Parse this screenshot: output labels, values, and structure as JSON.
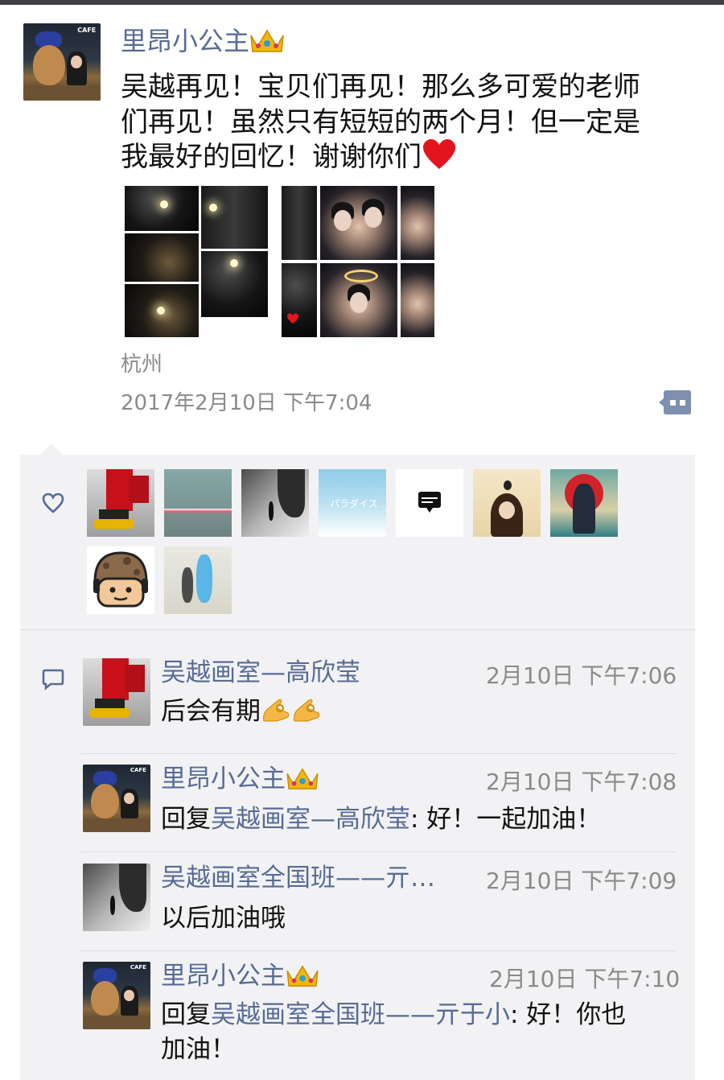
{
  "post": {
    "author": "里昂小公主",
    "author_icon": "crown-emoji",
    "text_lines": [
      "吴越再见！宝贝们再见！那么多可爱的老师",
      "们再见！虽然只有短短的两个月！但一定是",
      "我最好的回忆！谢谢你们"
    ],
    "text_end_icon": "red-heart-emoji",
    "location": "杭州",
    "timestamp": "2017年2月10日 下午7:04"
  },
  "likes": {
    "icon": "heart-outline-icon",
    "avatars": [
      "red-pants-sneakers",
      "teal-gradient-pink-line",
      "snowy-forest-bw",
      "sky-clouds-japanese-text",
      "black-speech-bubble-logo",
      "illustrated-girl-with-bird",
      "armored-hero-illustration",
      "cartoon-soldier-helmet",
      "figures-in-field"
    ],
    "avatar_caption_text": "パラダイス"
  },
  "comments_icon": "comment-bubble-icon",
  "comments": [
    {
      "author": "吴越画室—高欣莹",
      "time": "2月10日 下午7:06",
      "text": "后会有期",
      "emoji": "ok-hand-emoji ×2"
    },
    {
      "author": "里昂小公主",
      "time": "2月10日 下午7:08",
      "reply_prefix": "回复",
      "reply_to": "吴越画室—高欣莹",
      "text": ": 好！一起加油！"
    },
    {
      "author": "吴越画室全国班——亓…",
      "time": "2月10日 下午7:09",
      "text": "以后加油哦"
    },
    {
      "author": "里昂小公主",
      "time": "2月10日 下午7:10",
      "reply_prefix": "回复",
      "reply_to": "吴越画室全国班——亓于小",
      "text": ": 好！你也",
      "text_line2": "加油！"
    }
  ],
  "avatar_label": "CAFE",
  "colors": {
    "name_blue": "#576b95",
    "meta_gray": "#8a8a8a",
    "panel_bg": "#f2f2f4",
    "more_button": "#7e8fb0"
  }
}
